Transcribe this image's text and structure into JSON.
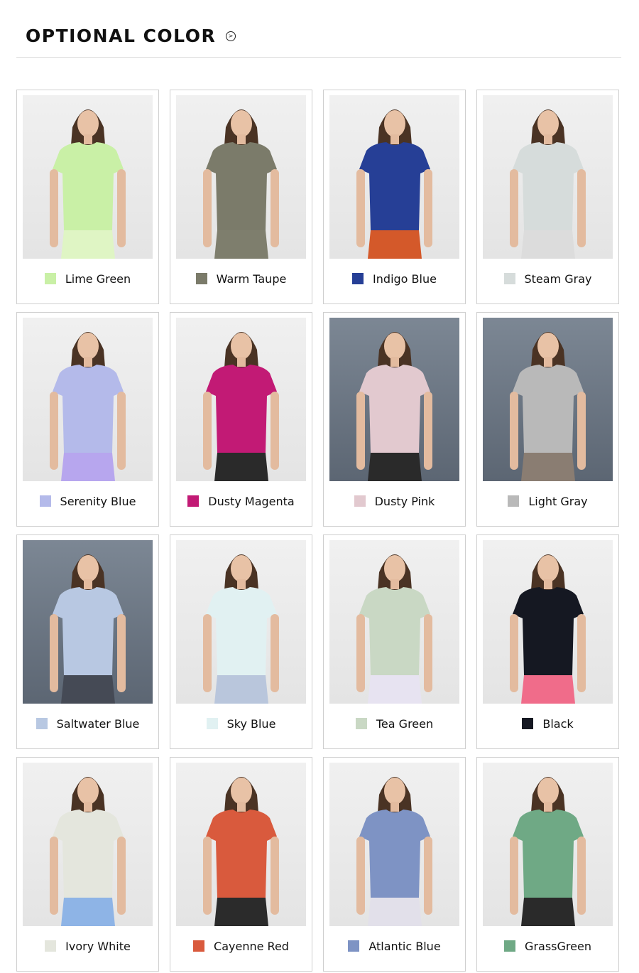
{
  "header": {
    "title": "OPTIONAL COLOR"
  },
  "colors": [
    {
      "name": "Lime Green",
      "shirt": "#c9f0a6",
      "bottom": "#dff5c4",
      "dark": false
    },
    {
      "name": "Warm Taupe",
      "shirt": "#7b7b6a",
      "bottom": "#7e7e6d",
      "dark": false
    },
    {
      "name": "Indigo Blue",
      "shirt": "#263f96",
      "bottom": "#d4592a",
      "dark": false
    },
    {
      "name": "Steam Gray",
      "shirt": "#d6dcdb",
      "bottom": "#dcdcdc",
      "dark": false
    },
    {
      "name": "Serenity Blue",
      "shirt": "#b4baea",
      "bottom": "#b7a6ee",
      "dark": false
    },
    {
      "name": "Dusty Magenta",
      "shirt": "#c21a75",
      "bottom": "#2a2a2a",
      "dark": false
    },
    {
      "name": "Dusty Pink",
      "shirt": "#e2c9cf",
      "bottom": "#2a2a2a",
      "dark": true
    },
    {
      "name": "Light Gray",
      "shirt": "#b9b9b9",
      "bottom": "#8a7d72",
      "dark": true
    },
    {
      "name": "Saltwater Blue",
      "shirt": "#b8c8e2",
      "bottom": "#454a55",
      "dark": true
    },
    {
      "name": "Sky Blue",
      "shirt": "#e1f1f2",
      "bottom": "#b9c6dc",
      "dark": false
    },
    {
      "name": "Tea Green",
      "shirt": "#c9d8c4",
      "bottom": "#e7e3f1",
      "dark": false
    },
    {
      "name": "Black",
      "shirt": "#151822",
      "bottom": "#f06c8a",
      "dark": false
    },
    {
      "name": "Ivory White",
      "shirt": "#e4e6dd",
      "bottom": "#8eb4e6",
      "dark": false
    },
    {
      "name": "Cayenne Red",
      "shirt": "#d95a3d",
      "bottom": "#2b2b2b",
      "dark": false
    },
    {
      "name": "Atlantic Blue",
      "shirt": "#7e93c4",
      "bottom": "#e2e0ea",
      "dark": false
    },
    {
      "name": "GrassGreen",
      "shirt": "#6fa985",
      "bottom": "#2a2a2a",
      "dark": false
    }
  ]
}
